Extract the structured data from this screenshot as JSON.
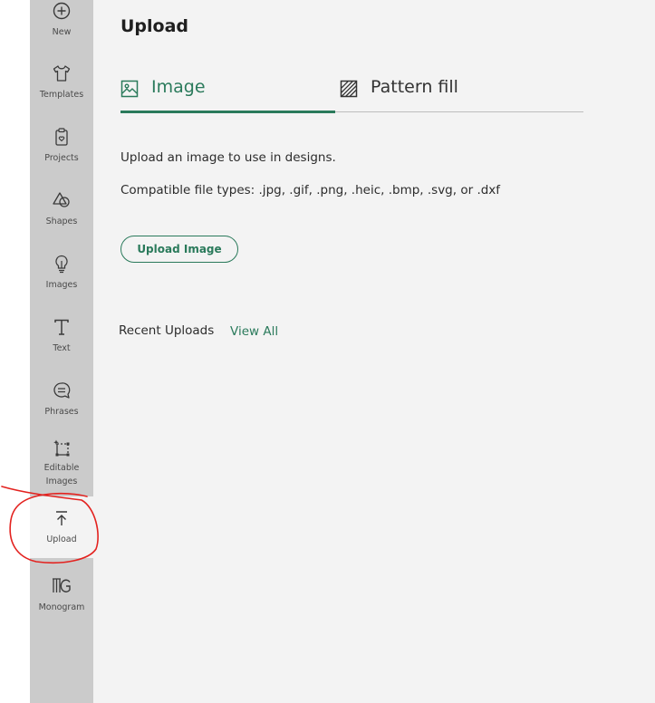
{
  "sidebar": {
    "items": [
      {
        "label": "New",
        "icon": "plus-circle-icon"
      },
      {
        "label": "Templates",
        "icon": "shirt-icon"
      },
      {
        "label": "Projects",
        "icon": "clipboard-heart-icon"
      },
      {
        "label": "Shapes",
        "icon": "shapes-icon"
      },
      {
        "label": "Images",
        "icon": "lightbulb-icon"
      },
      {
        "label": "Text",
        "icon": "text-t-icon"
      },
      {
        "label": "Phrases",
        "icon": "speech-bubble-icon"
      },
      {
        "label": "Editable",
        "label2": "Images",
        "icon": "editable-image-icon"
      },
      {
        "label": "Upload",
        "icon": "upload-arrow-icon",
        "active": true
      },
      {
        "label": "Monogram",
        "icon": "monogram-icon"
      }
    ]
  },
  "main": {
    "title": "Upload",
    "tabs": [
      {
        "label": "Image",
        "icon": "image-icon",
        "active": true
      },
      {
        "label": "Pattern fill",
        "icon": "pattern-fill-icon"
      }
    ],
    "description": "Upload an image to use in designs.",
    "file_types": "Compatible file types: .jpg, .gif, .png, .heic, .bmp, .svg, or .dxf",
    "upload_button": "Upload Image",
    "recent_uploads": "Recent Uploads",
    "view_all": "View All"
  },
  "colors": {
    "accent": "#2a7a5b",
    "sidebar_bg": "#cbcbcb",
    "panel_bg": "#f3f3f3",
    "annotation": "#e3221f"
  }
}
